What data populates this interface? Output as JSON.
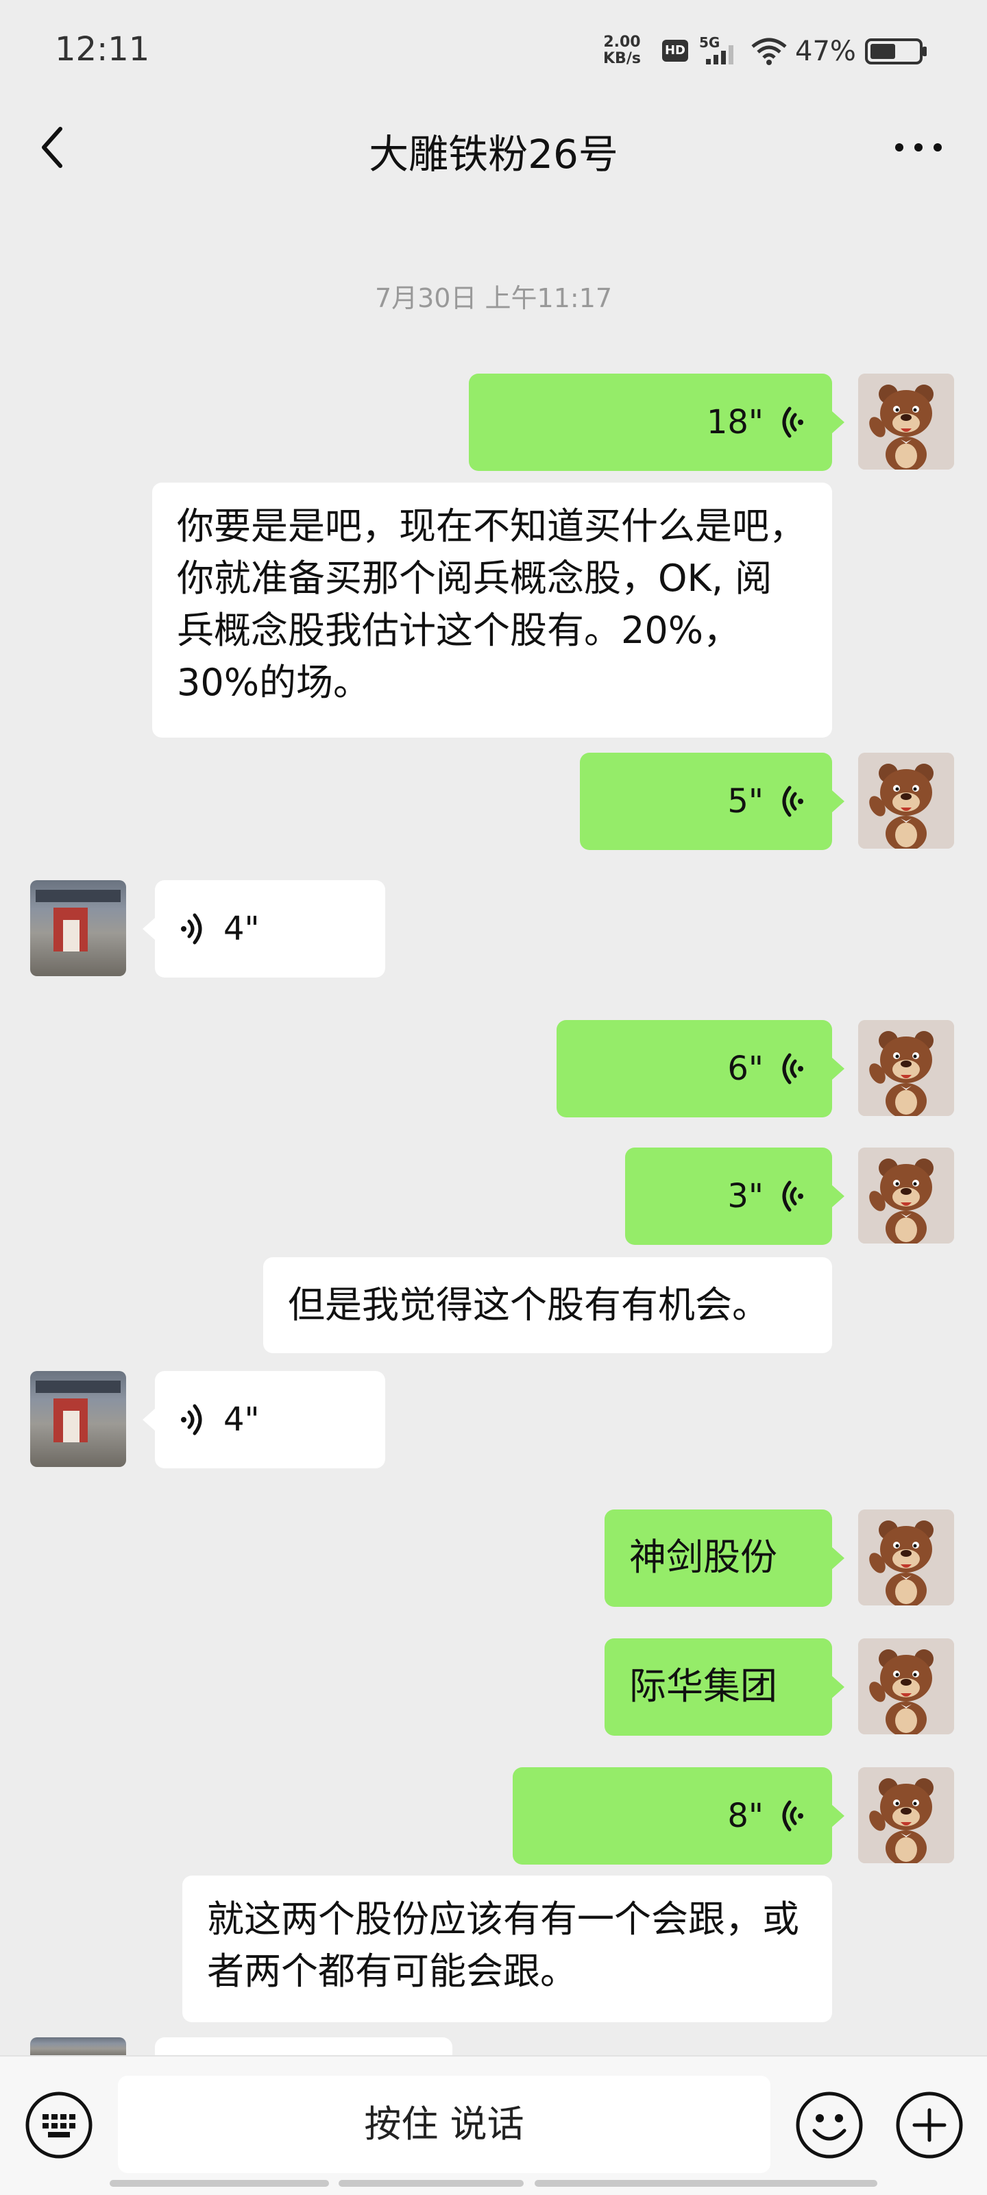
{
  "status_bar": {
    "time": "12:11",
    "net_speed_value": "2.00",
    "net_speed_unit": "KB/s",
    "hd": "HD",
    "network": "5G",
    "battery": "47%"
  },
  "header": {
    "title": "大雕铁粉26号",
    "back_icon": "chevron-left-icon",
    "more_icon": "ellipsis-icon"
  },
  "timestamp": "7月30日 上午11:17",
  "messages": [
    {
      "side": "right",
      "type": "voice",
      "duration": "18\""
    },
    {
      "side": "right",
      "type": "transcription",
      "text": "你要是是吧，现在不知道买什么是吧，你就准备买那个阅兵概念股，OK, 阅兵概念股我估计这个股有。20%，30%的场。"
    },
    {
      "side": "right",
      "type": "voice",
      "duration": "5\""
    },
    {
      "side": "left",
      "type": "voice",
      "duration": "4\""
    },
    {
      "side": "right",
      "type": "voice",
      "duration": "6\""
    },
    {
      "side": "right",
      "type": "voice",
      "duration": "3\""
    },
    {
      "side": "right",
      "type": "transcription",
      "text": "但是我觉得这个股有有机会。"
    },
    {
      "side": "left",
      "type": "voice",
      "duration": "4\""
    },
    {
      "side": "right",
      "type": "text",
      "text": "神剑股份"
    },
    {
      "side": "right",
      "type": "text",
      "text": "际华集团"
    },
    {
      "side": "right",
      "type": "voice",
      "duration": "8\""
    },
    {
      "side": "right",
      "type": "transcription",
      "text": "就这两个股份应该有有一个会跟，或者两个都有可能会跟。"
    }
  ],
  "input_bar": {
    "talk_label": "按住 说话",
    "keyboard_icon": "keyboard-icon",
    "emoji_icon": "emoji-icon",
    "plus_icon": "plus-icon"
  },
  "colors": {
    "background": "#ededed",
    "sent_bubble": "#95ec69",
    "received_bubble": "#ffffff"
  }
}
